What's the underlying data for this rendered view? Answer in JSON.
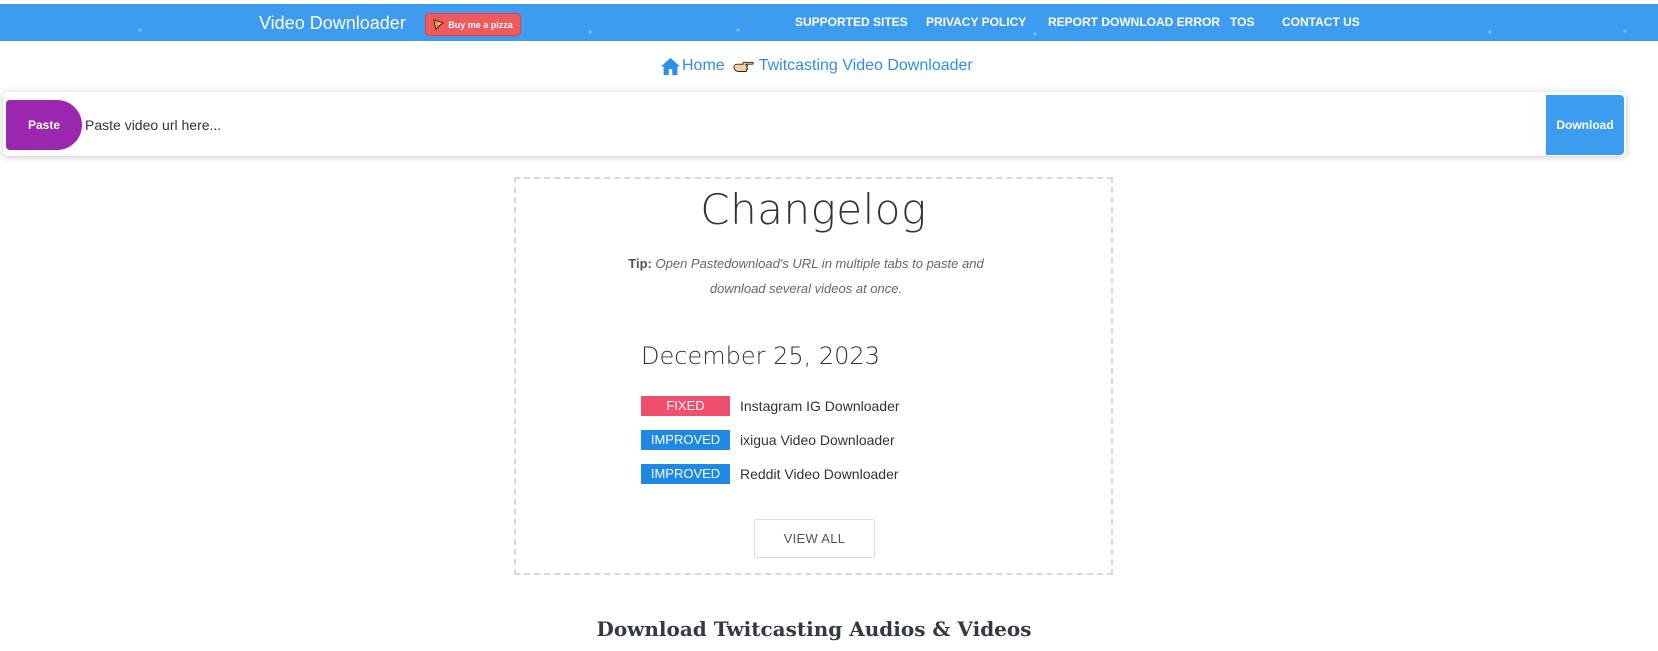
{
  "header": {
    "brand": "Video Downloader",
    "pizza_button": "Buy me a pizza",
    "nav": [
      "SUPPORTED SITES",
      "PRIVACY POLICY",
      "REPORT DOWNLOAD ERROR",
      "TOS",
      "CONTACT US"
    ],
    "bar_color": "#3d9cf0"
  },
  "breadcrumb": {
    "home": "Home",
    "current": "Twitcasting Video Downloader"
  },
  "search": {
    "paste_label": "Paste",
    "placeholder": "Paste video url here...",
    "download_label": "Download"
  },
  "changelog": {
    "title": "Changelog",
    "tip_label": "Tip:",
    "tip_text": "Open Pastedownload's URL in multiple tabs to paste and download several videos at once.",
    "date": "December 25, 2023",
    "entries": [
      {
        "badge": "FIXED",
        "text": "Instagram IG Downloader",
        "badge_color": "#ef4f6c"
      },
      {
        "badge": "IMPROVED",
        "text": "ixigua Video Downloader",
        "badge_color": "#1e88e5"
      },
      {
        "badge": "IMPROVED",
        "text": "Reddit Video Downloader",
        "badge_color": "#1e88e5"
      }
    ],
    "view_all": "VIEW ALL"
  },
  "section_heading": "Download Twitcasting Audios & Videos"
}
